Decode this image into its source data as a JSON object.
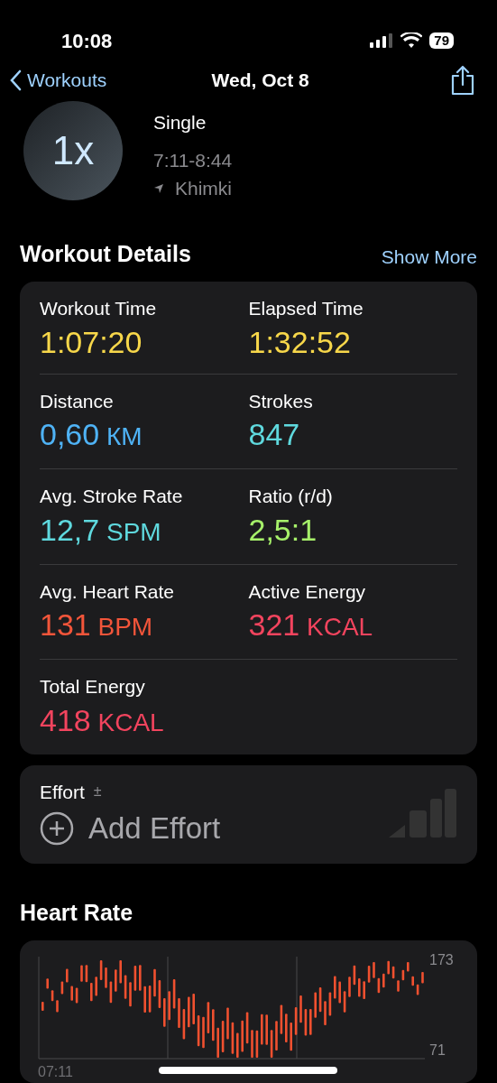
{
  "status_bar": {
    "time": "10:08",
    "battery": "79"
  },
  "nav": {
    "back": "Workouts",
    "title": "Wed, Oct 8"
  },
  "workout": {
    "badge": "1x",
    "name": "Single",
    "time_range": "7:11-8:44",
    "location": "Khimki"
  },
  "details": {
    "title": "Workout Details",
    "action": "Show More",
    "metrics": [
      {
        "label": "Workout Time",
        "value": "1:07:20",
        "color": "#f7d74a"
      },
      {
        "label": "Elapsed Time",
        "value": "1:32:52",
        "color": "#f7d74a"
      },
      {
        "label": "Distance",
        "value": "0,60",
        "unit": "КМ",
        "color": "#4fb3f6"
      },
      {
        "label": "Strokes",
        "value": "847",
        "color": "#5fd9de"
      },
      {
        "label": "Avg. Stroke Rate",
        "value": "12,7",
        "unit": "SPM",
        "color": "#5fd9de"
      },
      {
        "label": "Ratio (r/d)",
        "value": "2,5:1",
        "color": "#a6f06a"
      },
      {
        "label": "Avg. Heart Rate",
        "value": "131",
        "unit": "BPM",
        "color": "#f2553a"
      },
      {
        "label": "Active Energy",
        "value": "321",
        "unit": "KCAL",
        "color": "#f2445e"
      },
      {
        "label": "Total Energy",
        "value": "418",
        "unit": "KCAL",
        "color": "#f2445e"
      }
    ]
  },
  "effort": {
    "label": "Effort",
    "adjust": "±",
    "action": "Add Effort"
  },
  "heart_rate": {
    "title": "Heart Rate",
    "y_max": "173",
    "y_min": "71",
    "x_labels": [
      "07:11"
    ]
  }
}
